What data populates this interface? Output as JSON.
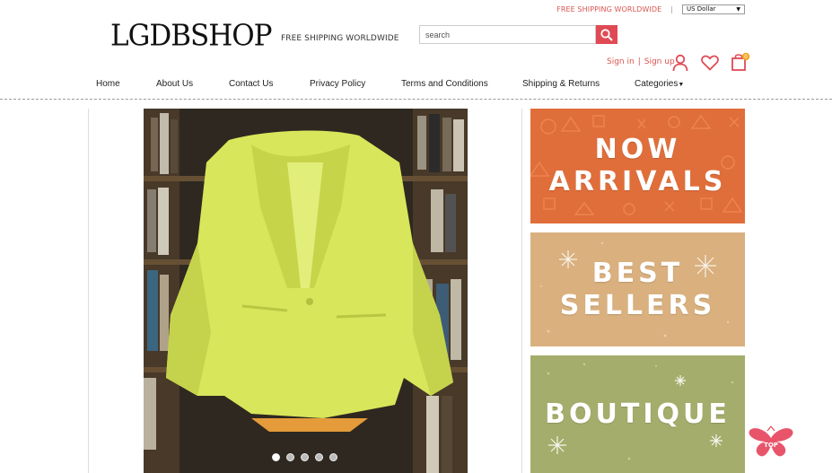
{
  "topbar": {
    "shipping_link": "FREE SHIPPING WORLDWIDE",
    "separator": "|",
    "currency": "US Dollar"
  },
  "header": {
    "logo": "LGDBSHOP",
    "free_shipping": "FREE SHIPPING WORLDWIDE",
    "search_placeholder": "search",
    "sign_in": "Sign in",
    "auth_separator": "|",
    "sign_up": "Sign up",
    "cart_count": "0"
  },
  "nav": {
    "items": [
      "Home",
      "About Us",
      "Contact Us",
      "Privacy Policy",
      "Terms and Conditions",
      "Shipping & Returns",
      "Categories"
    ]
  },
  "carousel": {
    "slides": 5,
    "active_index": 0
  },
  "banners": {
    "new_line1": "NOW",
    "new_line2": "ARRIVALS",
    "best_line1": "BEST",
    "best_line2": "SELLERS",
    "boutique": "BOUTIQUE"
  },
  "back_to_top": "TOP",
  "colors": {
    "accent": "#e04a55",
    "link_red": "#d9534f",
    "new_arrivals_bg": "#e06e3a",
    "best_sellers_bg": "#d9b07e",
    "boutique_bg": "#a4ad6b"
  },
  "icons": {
    "search": "search-icon",
    "user": "user-icon",
    "wishlist": "heart-icon",
    "cart": "shopping-bag-icon",
    "categories_caret": "caret-down-icon",
    "back_to_top": "butterfly-top-icon"
  }
}
